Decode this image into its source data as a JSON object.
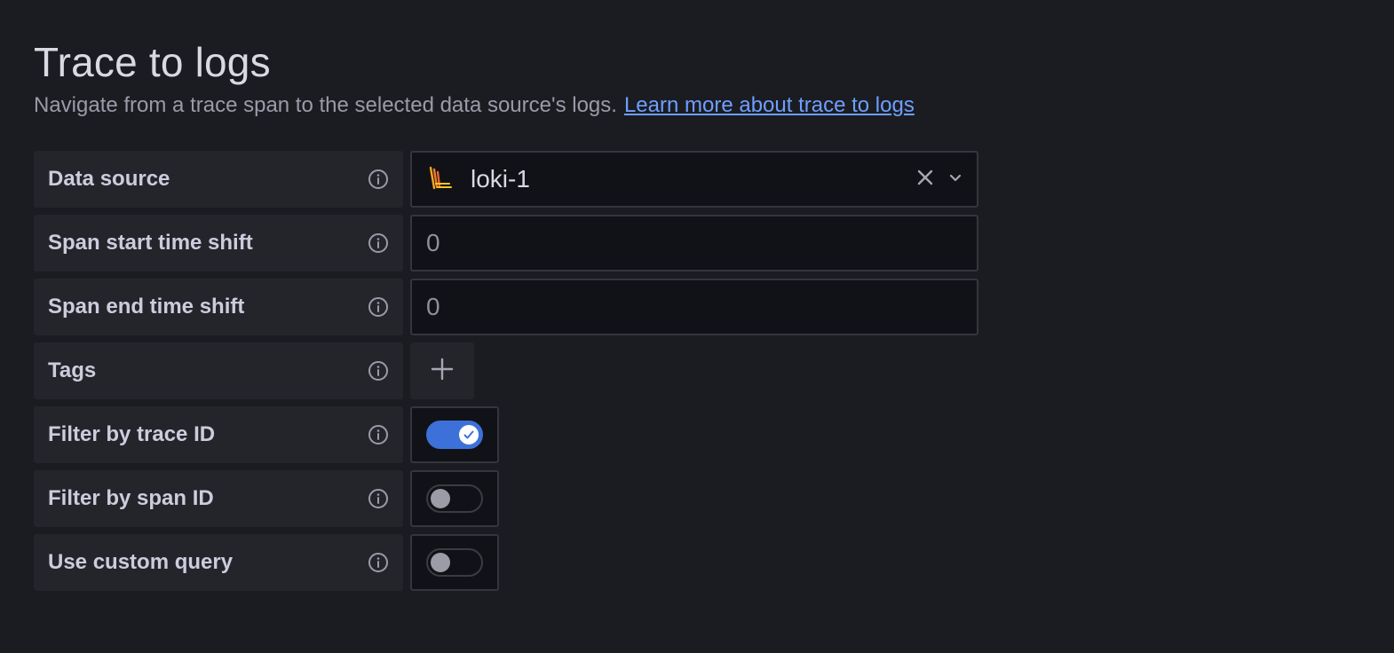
{
  "header": {
    "title": "Trace to logs",
    "description": "Navigate from a trace span to the selected data source's logs.",
    "learn_more_link": "Learn more about trace to logs"
  },
  "fields": {
    "data_source": {
      "label": "Data source",
      "value": "loki-1",
      "icon": "loki-logo-icon"
    },
    "span_start": {
      "label": "Span start time shift",
      "placeholder": "0",
      "value": ""
    },
    "span_end": {
      "label": "Span end time shift",
      "placeholder": "0",
      "value": ""
    },
    "tags": {
      "label": "Tags",
      "add_icon": "plus-icon"
    },
    "filter_trace_id": {
      "label": "Filter by trace ID",
      "enabled": true
    },
    "filter_span_id": {
      "label": "Filter by span ID",
      "enabled": false
    },
    "custom_query": {
      "label": "Use custom query",
      "enabled": false
    }
  },
  "colors": {
    "background": "#1b1c21",
    "label_bg": "#23252b",
    "input_bg": "#111217",
    "accent": "#3d71d9",
    "link": "#6e9fff"
  }
}
